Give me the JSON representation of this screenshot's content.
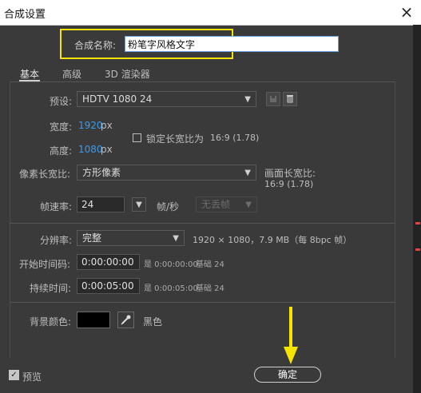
{
  "window": {
    "title": "合成设置",
    "close_glyph": "×"
  },
  "comp_name": {
    "label": "合成名称:",
    "value": "粉笔字风格文字"
  },
  "tabs": [
    {
      "label": "基本",
      "active": true
    },
    {
      "label": "高级",
      "active": false
    },
    {
      "label": "3D 渲染器",
      "active": false
    }
  ],
  "basic": {
    "preset": {
      "label": "预设:",
      "value": "HDTV 1080 24"
    },
    "width": {
      "label": "宽度:",
      "value": "1920",
      "unit": "px"
    },
    "height": {
      "label": "高度:",
      "value": "1080",
      "unit": "px"
    },
    "lock_ratio": {
      "label": "锁定长宽比为",
      "value": "16:9 (1.78)",
      "checked": false
    },
    "pixel_aspect": {
      "label": "像素长宽比:",
      "value": "方形像素"
    },
    "frame_aspect": {
      "label": "画面长宽比:",
      "value": "16:9 (1.78)"
    },
    "frame_rate": {
      "label": "帧速率:",
      "value": "24",
      "unit": "帧/秒",
      "drop_frame": "无丢帧"
    },
    "resolution": {
      "label": "分辨率:",
      "value": "完整",
      "info": "1920 × 1080，7.9 MB（每 8bpc 帧）"
    },
    "start_timecode": {
      "label": "开始时间码:",
      "value": "0:00:00:00",
      "note": "是 0:00:00:00",
      "base": "基础 24"
    },
    "duration": {
      "label": "持续时间:",
      "value": "0:00:05:00",
      "note": "是 0:00:05:00",
      "base": "基础 24"
    },
    "background": {
      "label": "背景颜色:",
      "color_name": "黑色",
      "color": "#000000"
    }
  },
  "footer": {
    "preview_label": "预览",
    "preview_checked": true,
    "ok_label": "确定"
  },
  "annotation_colors": {
    "highlight_box": "#f5e400",
    "arrow": "#f5e400"
  },
  "icons": [
    "close-icon",
    "chevron-down-icon",
    "save-preset-icon",
    "trash-icon",
    "eyedropper-icon",
    "checkmark-icon",
    "arrow-down-annotation-icon"
  ]
}
